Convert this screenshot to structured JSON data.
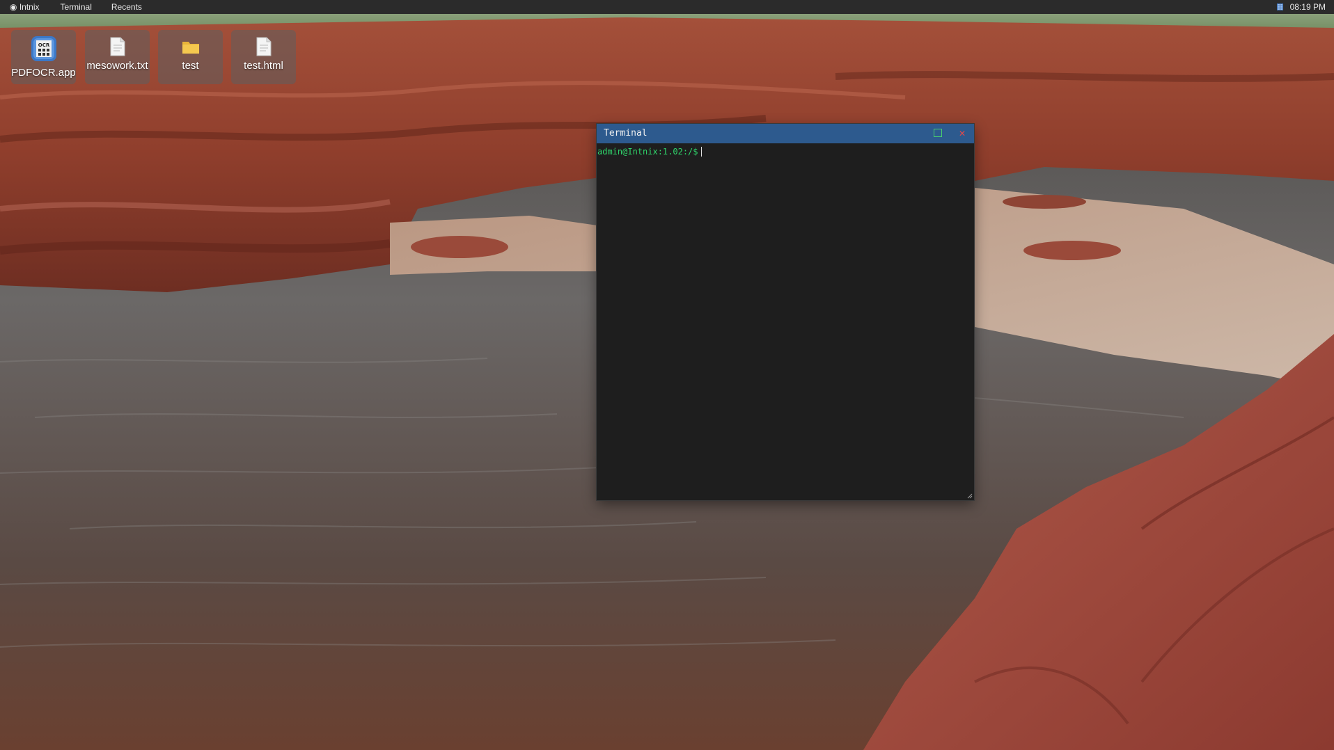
{
  "menubar": {
    "app_name": "Intnix",
    "items": [
      "Terminal",
      "Recents"
    ],
    "clock": "08:19 PM",
    "tray_icon": "grid-icon"
  },
  "desktop": {
    "icons": [
      {
        "label": "PDFOCR.app",
        "icon": "ocr-app-icon"
      },
      {
        "label": "mesowork.txt",
        "icon": "document-icon"
      },
      {
        "label": "test",
        "icon": "folder-icon"
      },
      {
        "label": "test.html",
        "icon": "document-icon"
      }
    ]
  },
  "terminal": {
    "title": "Terminal",
    "prompt": "admin@Intnix:1.02:/$",
    "colors": {
      "titlebar": "#2d5a8e",
      "background": "#1e1e1e",
      "prompt": "#2fd66b",
      "maximize": "#49d06d",
      "close": "#e24a4a"
    }
  }
}
